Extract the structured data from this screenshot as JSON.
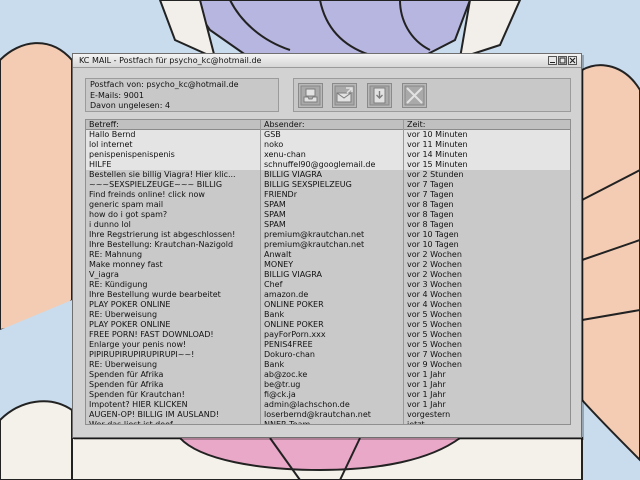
{
  "window": {
    "title": "KC MAIL - Postfach für psycho_kc@hotmail.de",
    "controls": [
      "minimize-icon",
      "maximize-icon",
      "close-icon"
    ]
  },
  "mailbox_info": {
    "postfach": "Postfach von: psycho_kc@hotmail.de",
    "emails": "E-Mails: 9001",
    "unread": "Davon ungelesen: 4"
  },
  "toolbar": {
    "buttons": [
      "inbox-icon",
      "compose-mail-icon",
      "save-icon",
      "delete-icon"
    ]
  },
  "table": {
    "headers": [
      "Betreff:",
      "Absender:",
      "Zeit:"
    ],
    "unread_rows": 4,
    "rows": [
      [
        "Hallo Bernd",
        "GSB",
        "vor 10 Minuten"
      ],
      [
        "lol internet",
        "noko",
        "vor 11 Minuten"
      ],
      [
        "penispenispenispenis",
        "xenu-chan",
        "vor 14 Minuten"
      ],
      [
        "HILFE",
        "schnuffel90@googlemail.de",
        "vor 15 Minuten"
      ],
      [
        "Bestellen sie billig Viagra! Hier klic...",
        "BILLIG VIAGRA",
        "vor 2 Stunden"
      ],
      [
        "~~~SEXSPIELZEUGE~~~ BILLIG",
        "BILLIG SEXSPIELZEUG",
        "vor 7 Tagen"
      ],
      [
        "Find freinds online! click now",
        "FRIENDr",
        "vor 7 Tagen"
      ],
      [
        "generic spam mail",
        "SPAM",
        "vor 8 Tagen"
      ],
      [
        "how do i got spam?",
        "SPAM",
        "vor 8 Tagen"
      ],
      [
        "i dunno lol",
        "SPAM",
        "vor 8 Tagen"
      ],
      [
        "Ihre Regstrierung ist abgeschlossen!",
        "premium@krautchan.net",
        "vor 10 Tagen"
      ],
      [
        "Ihre Bestellung: Krautchan-Nazigold",
        "premium@krautchan.net",
        "vor 10 Tagen"
      ],
      [
        "RE: Mahnung",
        "Anwalt",
        "vor 2 Wochen"
      ],
      [
        "Make monney fast",
        "MONEY",
        "vor 2 Wochen"
      ],
      [
        "V_iagra",
        "BILLIG VIAGRA",
        "vor 2 Wochen"
      ],
      [
        "RE: Kündigung",
        "Chef",
        "vor 3 Wochen"
      ],
      [
        "Ihre Bestellung wurde bearbeitet",
        "amazon.de",
        "vor 4 Wochen"
      ],
      [
        "PLAY POKER ONLINE",
        "ONLINE POKER",
        "vor 4 Wochen"
      ],
      [
        "RE: Überweisung",
        "Bank",
        "vor 5 Wochen"
      ],
      [
        "PLAY POKER ONLINE",
        "ONLINE POKER",
        "vor 5 Wochen"
      ],
      [
        "FREE PORN! FAST DOWNLOAD!",
        "payForPorn.xxx",
        "vor 5 Wochen"
      ],
      [
        "Enlarge your penis now!",
        "PENIS4FREE",
        "vor 5 Wochen"
      ],
      [
        "PIPIRUPIRUPIRUPIRUPI~~!",
        "Dokuro-chan",
        "vor 7 Wochen"
      ],
      [
        "RE: Überweisung",
        "Bank",
        "vor 9 Wochen"
      ],
      [
        "Spenden für Afrika",
        "ab@zoc.ke",
        "vor 1 Jahr"
      ],
      [
        "Spenden für Afrika",
        "be@tr.ug",
        "vor 1 Jahr"
      ],
      [
        "Spenden für Krautchan!",
        "fi@ck.ja",
        "vor 1 Jahr"
      ],
      [
        "Impotent? HIER KLICKEN",
        "admin@lachschon.de",
        "vor 1 Jahr"
      ],
      [
        "AUGEN-OP! BILLIG IM AUSLAND!",
        "loserbernd@krautchan.net",
        "vorgestern"
      ],
      [
        "Wer das liest ist doof",
        "NNER Team",
        "jetzt"
      ]
    ]
  }
}
